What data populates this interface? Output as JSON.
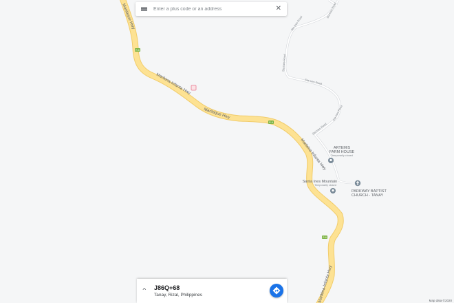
{
  "search": {
    "placeholder": "Enter a plus code or an address"
  },
  "roads": {
    "marilaque_hwy_top": "Marilaque Hwy",
    "marikina_infanta_hwy_1": "Marikina-Infanta Hwy",
    "marilaque_hwy_mid": "Marilaque Hwy",
    "marikina_infanta_hwy_2": "Marikina-Infanta Hwy",
    "marikina_infanta_hwy_3": "Marikina-Infanta Hwy",
    "sta_ines_road_1": "Sta Ines Road",
    "sta_ines_road_2": "Sta Ines Road",
    "sta_ines_road_3": "Sta Ines Road",
    "sta_ines_road_4": "Sta Ines Road",
    "sta_ines_road_5": "Sta Ines Road",
    "sta_ines_road_6": "Sta Ines Road"
  },
  "route_shields": [
    "R-6",
    "R-6",
    "R-6"
  ],
  "places": {
    "artemis": {
      "name_line1": "ARTEMIS",
      "name_line2": "FARM HOUSE",
      "status": "Temporarily closed"
    },
    "santa_ines": {
      "name": "Santa Ines Mountain",
      "status": "Temporarily closed"
    },
    "parkway": {
      "name_line1": "PARKWAY BAPTIST",
      "name_line2": "CHURCH - TANAY"
    }
  },
  "location_card": {
    "plus_code": "J86Q+68",
    "address": "Tanay, Rizal, Philippines"
  },
  "attribution": "Map data ©2020",
  "colors": {
    "map_background": "#f5f6f7",
    "highway_fill": "#fde293",
    "highway_casing": "#f1cc6b",
    "local_road": "#ffffff",
    "local_road_casing": "#d5d8dc",
    "route_shield": "#7cb342",
    "poi_marker": "#7a8b99",
    "directions_button": "#1a73e8"
  },
  "icons": [
    "menu-icon",
    "close-icon",
    "chevron-up-icon",
    "directions-icon",
    "poi-marker-icon",
    "place-of-worship-icon",
    "toll-icon"
  ]
}
